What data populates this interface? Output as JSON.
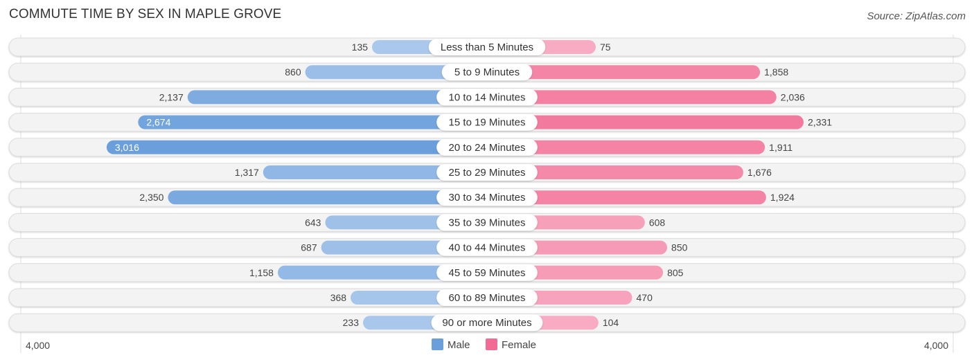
{
  "title": "COMMUTE TIME BY SEX IN MAPLE GROVE",
  "source": "Source: ZipAtlas.com",
  "chart_data": {
    "type": "bar",
    "orientation": "horizontal-diverging",
    "title": "COMMUTE TIME BY SEX IN MAPLE GROVE",
    "categories": [
      "Less than 5 Minutes",
      "5 to 9 Minutes",
      "10 to 14 Minutes",
      "15 to 19 Minutes",
      "20 to 24 Minutes",
      "25 to 29 Minutes",
      "30 to 34 Minutes",
      "35 to 39 Minutes",
      "40 to 44 Minutes",
      "45 to 59 Minutes",
      "60 to 89 Minutes",
      "90 or more Minutes"
    ],
    "series": [
      {
        "name": "Male",
        "color": "#6a9fdc",
        "values": [
          135,
          860,
          2137,
          2674,
          3016,
          1317,
          2350,
          643,
          687,
          1158,
          368,
          233
        ]
      },
      {
        "name": "Female",
        "color": "#f26b94",
        "values": [
          75,
          1858,
          2036,
          2331,
          1911,
          1676,
          1924,
          608,
          850,
          805,
          470,
          104
        ]
      }
    ],
    "value_labels": {
      "male": [
        "135",
        "860",
        "2,137",
        "2,674",
        "3,016",
        "1,317",
        "2,350",
        "643",
        "687",
        "1,158",
        "368",
        "233"
      ],
      "female": [
        "75",
        "1,858",
        "2,036",
        "2,331",
        "1,911",
        "1,676",
        "1,924",
        "608",
        "850",
        "805",
        "470",
        "104"
      ]
    },
    "axis_max": 4000,
    "axis_tick_labels": {
      "left": "4,000",
      "right": "4,000"
    },
    "legend": [
      "Male",
      "Female"
    ],
    "legend_position": "bottom-center",
    "grid": false
  }
}
